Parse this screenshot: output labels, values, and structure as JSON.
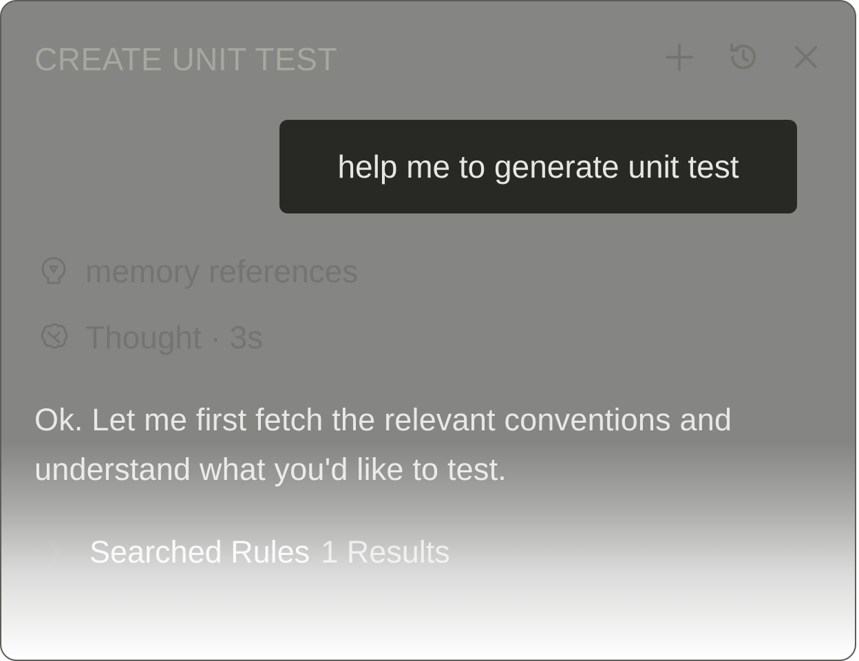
{
  "header": {
    "title": "CREATE UNIT TEST",
    "icons": [
      "plus-icon",
      "history-icon",
      "close-icon"
    ]
  },
  "conversation": {
    "user_message": "help me to generate unit test",
    "memory": {
      "label": "memory references",
      "icon": "memory-icon"
    },
    "thought": {
      "label": "Thought · 3s",
      "icon": "thought-icon"
    },
    "assistant_message": "Ok. Let me first fetch the relevant conventions and understand what you'd like to test.",
    "tool_call": {
      "label": "Searched Rules",
      "count": "1 Results",
      "icon": "chevron-right-icon"
    }
  },
  "colors": {
    "panel_bg": "#858583",
    "bubble_bg": "#282925",
    "title_text": "#a6a79f",
    "muted_text": "#747572",
    "body_text": "#e8e8e5"
  }
}
